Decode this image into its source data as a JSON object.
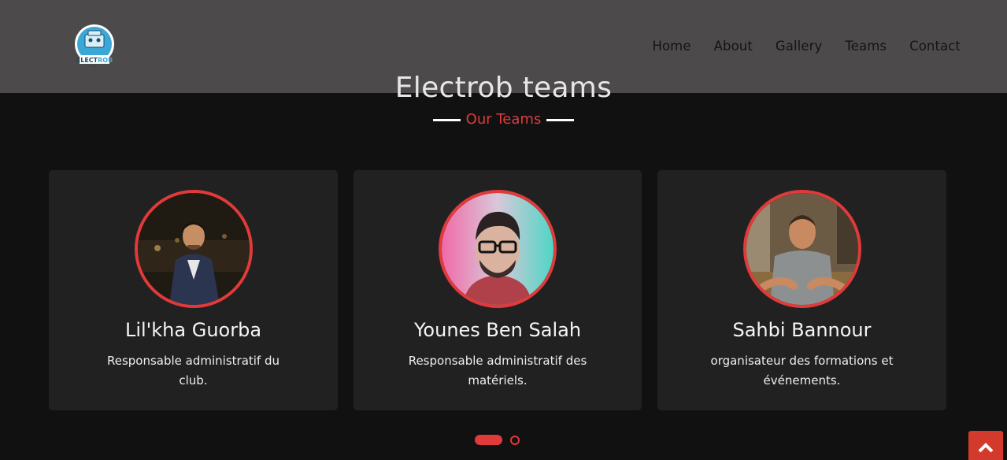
{
  "header": {
    "logo_text": "ELECTROB",
    "nav": [
      "Home",
      "About",
      "Gallery",
      "Teams",
      "Contact"
    ]
  },
  "section": {
    "title": "Electrob teams",
    "subtitle": "Our Teams"
  },
  "team": [
    {
      "name": "Lil'kha Guorba",
      "role": "Responsable administratif du club."
    },
    {
      "name": "Younes Ben Salah",
      "role": "Responsable administratif des matériels."
    },
    {
      "name": "Sahbi Bannour",
      "role": "organisateur des formations et événements."
    }
  ],
  "carousel": {
    "pages": 2,
    "active": 1
  },
  "colors": {
    "accent": "#e03a3a",
    "header_bg": "#4d4a4b",
    "page_bg": "#121112",
    "card_bg": "#222122"
  },
  "icons": {
    "back_to_top": "chevron-up-icon"
  }
}
